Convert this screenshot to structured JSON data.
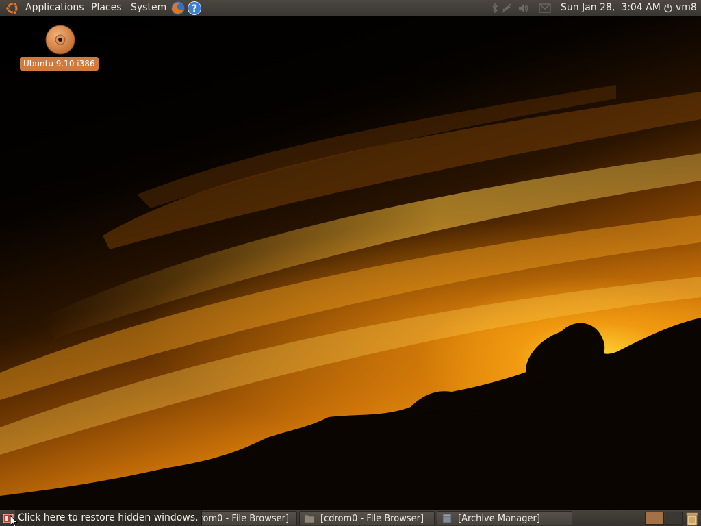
{
  "top_panel": {
    "menus": [
      "Applications",
      "Places",
      "System"
    ],
    "clock": "Sun Jan 28,  3:04 AM",
    "user": "vm8"
  },
  "desktop": {
    "icons": [
      {
        "label": "Ubuntu 9.10 i386",
        "icon": "cd-disc-icon"
      }
    ]
  },
  "bottom_panel": {
    "show_desktop_tooltip": "Click here to restore hidden windows.",
    "tasks": [
      {
        "label": "[cdrom0 - File Browser]",
        "icon": "folder-icon"
      },
      {
        "label": "[cdrom0 - File Browser]",
        "icon": "folder-icon"
      },
      {
        "label": "[Archive Manager]",
        "icon": "archive-icon"
      }
    ]
  },
  "colors": {
    "panel": "#3f3b35",
    "icon_label_bg": "#d07a3c",
    "workspace_active": "#a47144"
  }
}
